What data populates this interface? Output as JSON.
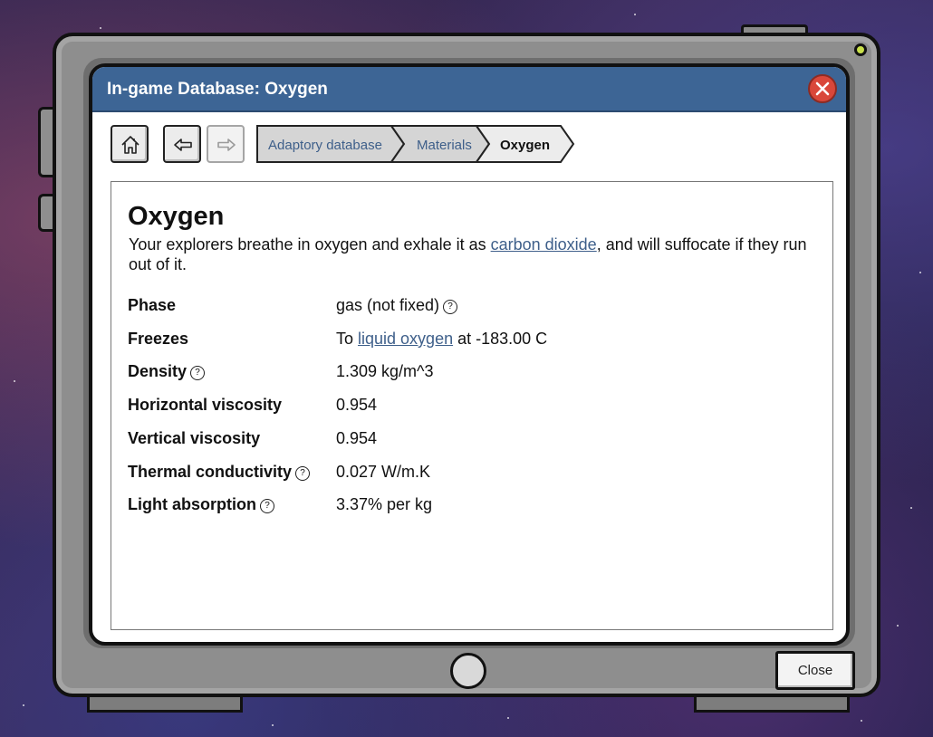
{
  "window": {
    "title": "In-game Database: Oxygen",
    "close_label": "Close"
  },
  "nav": {
    "home_icon": "home-icon",
    "back_icon": "arrow-left-icon",
    "forward_icon": "arrow-right-icon",
    "forward_enabled": false
  },
  "breadcrumbs": [
    {
      "label": "Adaptory database",
      "current": false
    },
    {
      "label": "Materials",
      "current": false
    },
    {
      "label": "Oxygen",
      "current": true
    }
  ],
  "entry": {
    "heading": "Oxygen",
    "description_before": "Your explorers breathe in oxygen and exhale it as ",
    "description_link": "carbon dioxide",
    "description_after": ", and will suffocate if they run out of it.",
    "properties": [
      {
        "label": "Phase",
        "value": "gas (not fixed)",
        "label_help": false,
        "value_help": true
      },
      {
        "label": "Freezes",
        "value_prefix": "To ",
        "value_link": "liquid oxygen",
        "value_suffix": " at -183.00 C",
        "label_help": false,
        "value_help": false
      },
      {
        "label": "Density",
        "value": "1.309 kg/m^3",
        "label_help": true,
        "value_help": false
      },
      {
        "label": "Horizontal viscosity",
        "value": "0.954",
        "label_help": false,
        "value_help": false
      },
      {
        "label": "Vertical viscosity",
        "value": "0.954",
        "label_help": false,
        "value_help": false
      },
      {
        "label": "Thermal conductivity",
        "value": "0.027 W/m.K",
        "label_help": true,
        "value_help": false
      },
      {
        "label": "Light absorption",
        "value": "3.37% per kg",
        "label_help": true,
        "value_help": false
      }
    ]
  },
  "help_glyph": "?",
  "colors": {
    "titlebar": "#3d6595",
    "close_x": "#d9473a",
    "link": "#3e5f8a",
    "led": "#c9e04a"
  }
}
